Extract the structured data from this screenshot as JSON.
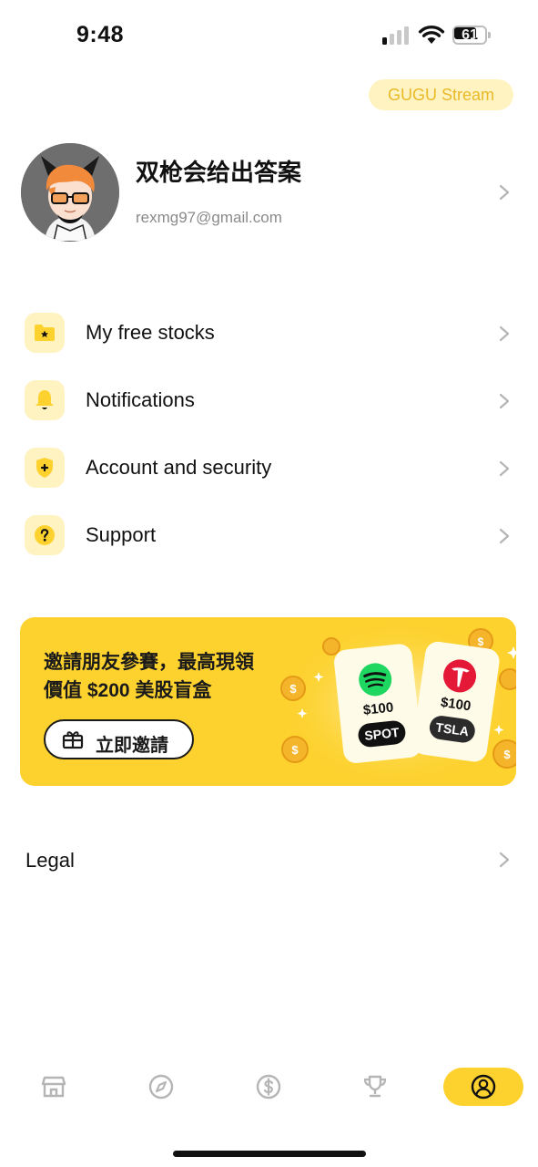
{
  "status_bar": {
    "time": "9:48",
    "battery": "61"
  },
  "stream_pill": {
    "label": "GUGU Stream"
  },
  "profile": {
    "name": "双枪会给出答案",
    "email": "rexmg97@gmail.com"
  },
  "menu": [
    {
      "label": "My free stocks",
      "icon": "folder-star-icon"
    },
    {
      "label": "Notifications",
      "icon": "bell-icon"
    },
    {
      "label": "Account and security",
      "icon": "shield-plus-icon"
    },
    {
      "label": "Support",
      "icon": "question-icon"
    }
  ],
  "banner": {
    "line1": "邀請朋友參賽，最高現領",
    "line2": "價值 $200 美股盲盒",
    "button_label": "立即邀請",
    "cards": [
      {
        "amount": "$100",
        "ticker": "SPOT"
      },
      {
        "amount": "$100",
        "ticker": "TSLA"
      }
    ],
    "accent": "#fdd22f"
  },
  "legal": {
    "label": "Legal"
  },
  "tabs": [
    {
      "icon": "store-icon",
      "active": false
    },
    {
      "icon": "compass-icon",
      "active": false
    },
    {
      "icon": "dollar-icon",
      "active": false
    },
    {
      "icon": "trophy-icon",
      "active": false
    },
    {
      "icon": "profile-icon",
      "active": true
    }
  ]
}
